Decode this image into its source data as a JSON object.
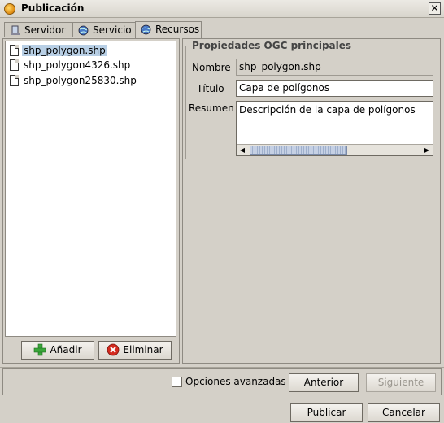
{
  "window": {
    "title": "Publicación"
  },
  "tabs": [
    {
      "label": "Servidor",
      "icon": "server-icon"
    },
    {
      "label": "Servicio",
      "icon": "globe-icon"
    },
    {
      "label": "Recursos",
      "icon": "globe-icon",
      "active": true
    }
  ],
  "resources": {
    "files": [
      {
        "name": "shp_polygon.shp",
        "selected": true
      },
      {
        "name": "shp_polygon4326.shp"
      },
      {
        "name": "shp_polygon25830.shp"
      }
    ],
    "add_label": "Añadir",
    "remove_label": "Eliminar"
  },
  "properties": {
    "group_title": "Propiedades OGC principales",
    "name_label": "Nombre",
    "name_value": "shp_polygon.shp",
    "title_label": "Título",
    "title_value": "Capa de polígonos",
    "summary_label": "Resumen",
    "summary_value": "Descripción de la capa de polígonos"
  },
  "wizard": {
    "advanced_options_label": "Opciones avanzadas",
    "advanced_options_checked": false,
    "previous_label": "Anterior",
    "next_label": "Siguiente",
    "next_enabled": false
  },
  "actions": {
    "publish_label": "Publicar",
    "cancel_label": "Cancelar"
  },
  "colors": {
    "window_bg": "#d4d0c8",
    "selection": "#b8cfe5",
    "add_icon": "#3aa63a",
    "remove_icon": "#d42a1e"
  }
}
